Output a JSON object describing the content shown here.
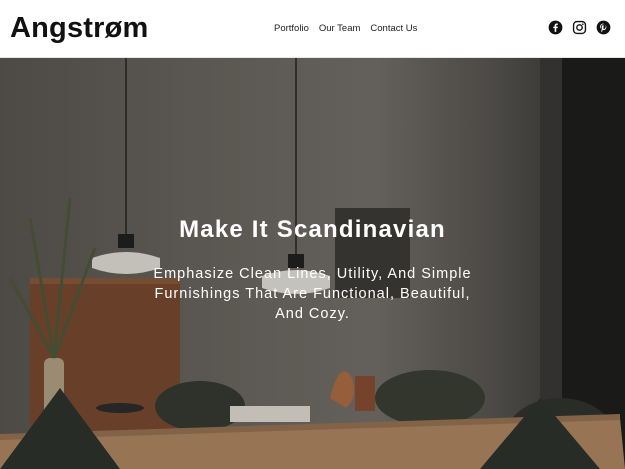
{
  "brand": {
    "name": "Angstrøm"
  },
  "nav": {
    "items": [
      {
        "label": "Portfolio"
      },
      {
        "label": "Our Team"
      },
      {
        "label": "Contact Us"
      }
    ]
  },
  "social": [
    {
      "icon": "facebook-icon"
    },
    {
      "icon": "instagram-icon"
    },
    {
      "icon": "pinterest-icon"
    }
  ],
  "hero": {
    "title": "Make It Scandinavian",
    "subtitle": "Emphasize Clean Lines, Utility, And Simple Furnishings That Are Functional, Beautiful, And Cozy."
  },
  "colors": {
    "header_bg": "#ffffff",
    "text": "#111111",
    "hero_text": "#ffffff"
  }
}
